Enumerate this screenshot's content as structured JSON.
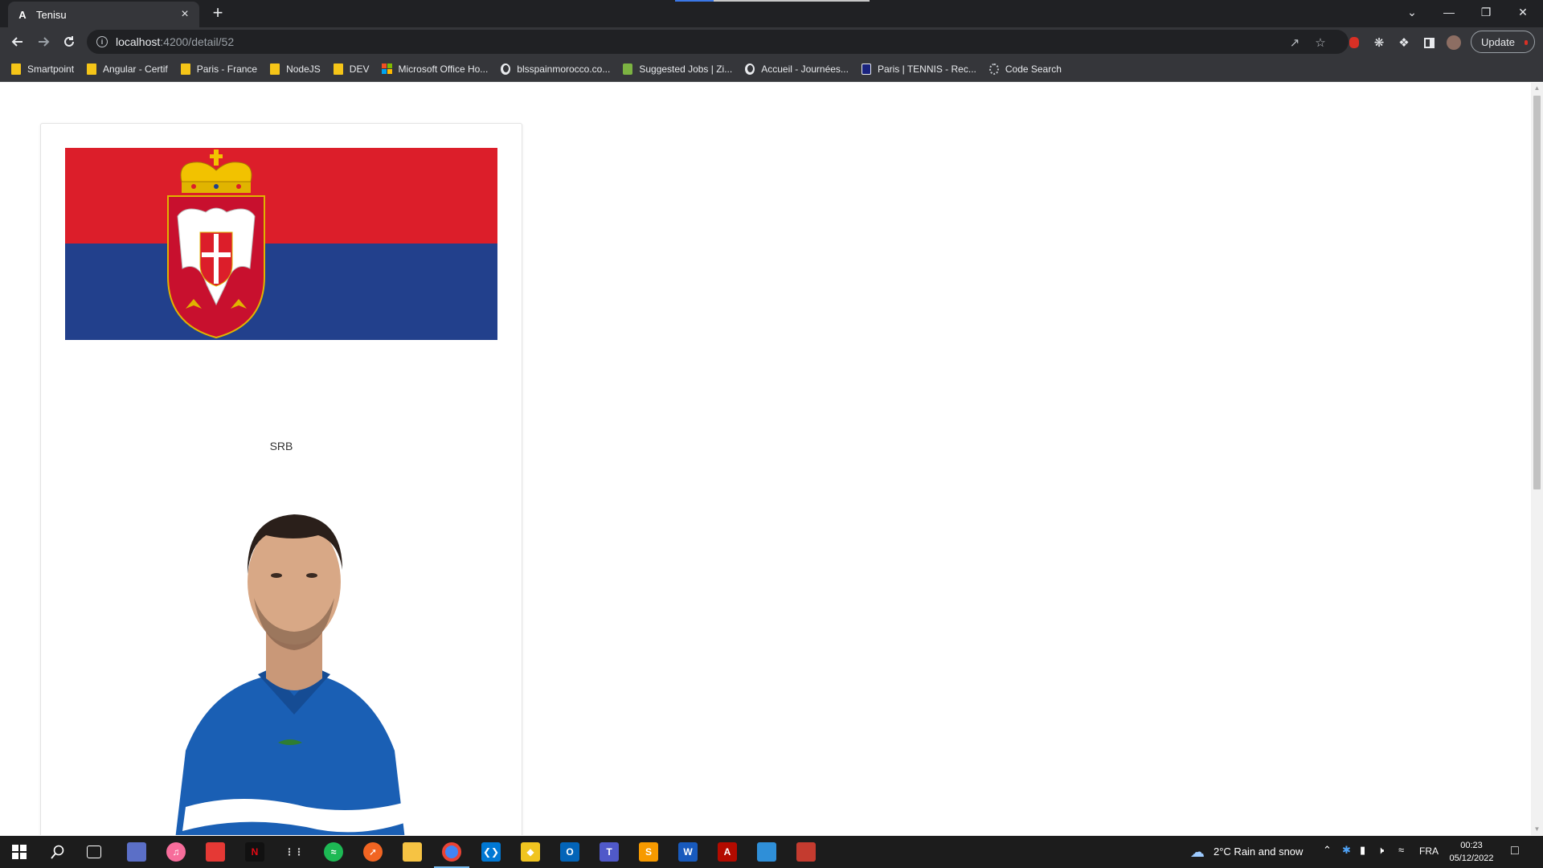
{
  "browser": {
    "tab": {
      "title": "Tenisu",
      "favicon": "A"
    },
    "url": {
      "host": "localhost",
      "rest": ":4200/detail/52"
    },
    "update_label": "Update"
  },
  "bookmarks": [
    {
      "label": "Smartpoint",
      "icon": "folder-icon"
    },
    {
      "label": "Angular - Certif",
      "icon": "folder-icon"
    },
    {
      "label": "Paris - France",
      "icon": "folder-icon"
    },
    {
      "label": "NodeJS",
      "icon": "folder-icon"
    },
    {
      "label": "DEV",
      "icon": "folder-icon"
    },
    {
      "label": "Microsoft Office Ho...",
      "icon": "microsoft-icon"
    },
    {
      "label": "blsspainmorocco.co...",
      "icon": "globe-icon"
    },
    {
      "label": "Suggested Jobs | Zi...",
      "icon": "ziprecruiter-icon"
    },
    {
      "label": "Accueil - Journées...",
      "icon": "globe-icon"
    },
    {
      "label": "Paris | TENNIS - Rec...",
      "icon": "site-icon"
    },
    {
      "label": "Code Search",
      "icon": "gear-icon"
    }
  ],
  "content": {
    "country_code": "SRB",
    "flag": "serbia-flag",
    "player_photo": "player-photo"
  },
  "taskbar": {
    "weather": "2°C  Rain and snow",
    "language": "FRA",
    "time": "00:23",
    "date": "05/12/2022"
  }
}
